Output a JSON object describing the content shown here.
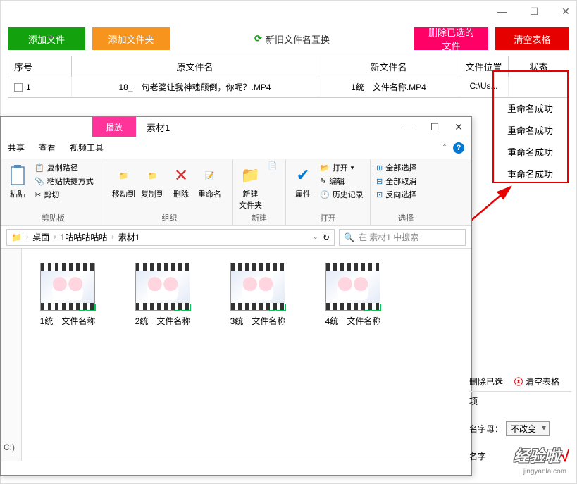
{
  "main": {
    "buttons": {
      "add_file": "添加文件",
      "add_folder": "添加文件夹",
      "swap": "新旧文件名互换",
      "delete_selected": "删除已选的文件",
      "clear_table": "清空表格"
    },
    "table": {
      "headers": {
        "seq": "序号",
        "orig": "原文件名",
        "new_name": "新文件名",
        "location": "文件位置",
        "status": "状态"
      },
      "row1": {
        "seq": "1",
        "orig": "18_一句老婆让我神魂颠倒，你呢？.MP4",
        "new_name": "1统一文件名称.MP4",
        "location": "C:\\Us..."
      },
      "statuses": [
        "重命名成功",
        "重命名成功",
        "重命名成功",
        "重命名成功"
      ]
    }
  },
  "explorer": {
    "tabs": {
      "share": "共享",
      "view": "查看",
      "play": "播放",
      "video_tools": "视频工具"
    },
    "title": "素材1",
    "ribbon": {
      "clipboard": {
        "label": "剪贴板",
        "paste": "粘贴",
        "copy_path": "复制路径",
        "paste_shortcut": "粘贴快捷方式",
        "cut": "剪切"
      },
      "organize": {
        "label": "组织",
        "move_to": "移动到",
        "copy_to": "复制到",
        "delete": "删除",
        "rename": "重命名"
      },
      "new_group": {
        "label": "新建",
        "new_folder": "新建\n文件夹"
      },
      "open_group": {
        "label": "打开",
        "properties": "属性",
        "open": "打开",
        "edit": "编辑",
        "history": "历史记录"
      },
      "select_group": {
        "label": "选择",
        "select_all": "全部选择",
        "deselect_all": "全部取消",
        "invert": "反向选择"
      }
    },
    "path": {
      "desktop": "桌面",
      "folder1": "1咕咕咕咕咕",
      "folder2": "素材1"
    },
    "search_placeholder": "在 素材1 中搜索",
    "files": [
      "1统一文件名称",
      "2统一文件名称",
      "3统一文件名称",
      "4统一文件名称"
    ],
    "iqy": "iQIYI",
    "drive": "C:)"
  },
  "right_panel": {
    "delete_sel": "删除已选",
    "clear_tbl": "清空表格",
    "option": "项",
    "letter": "名字母：",
    "no_change": "不改变",
    "name_word": "名字"
  },
  "watermark": {
    "text": "经验啦",
    "url": "jingyanla.com"
  }
}
